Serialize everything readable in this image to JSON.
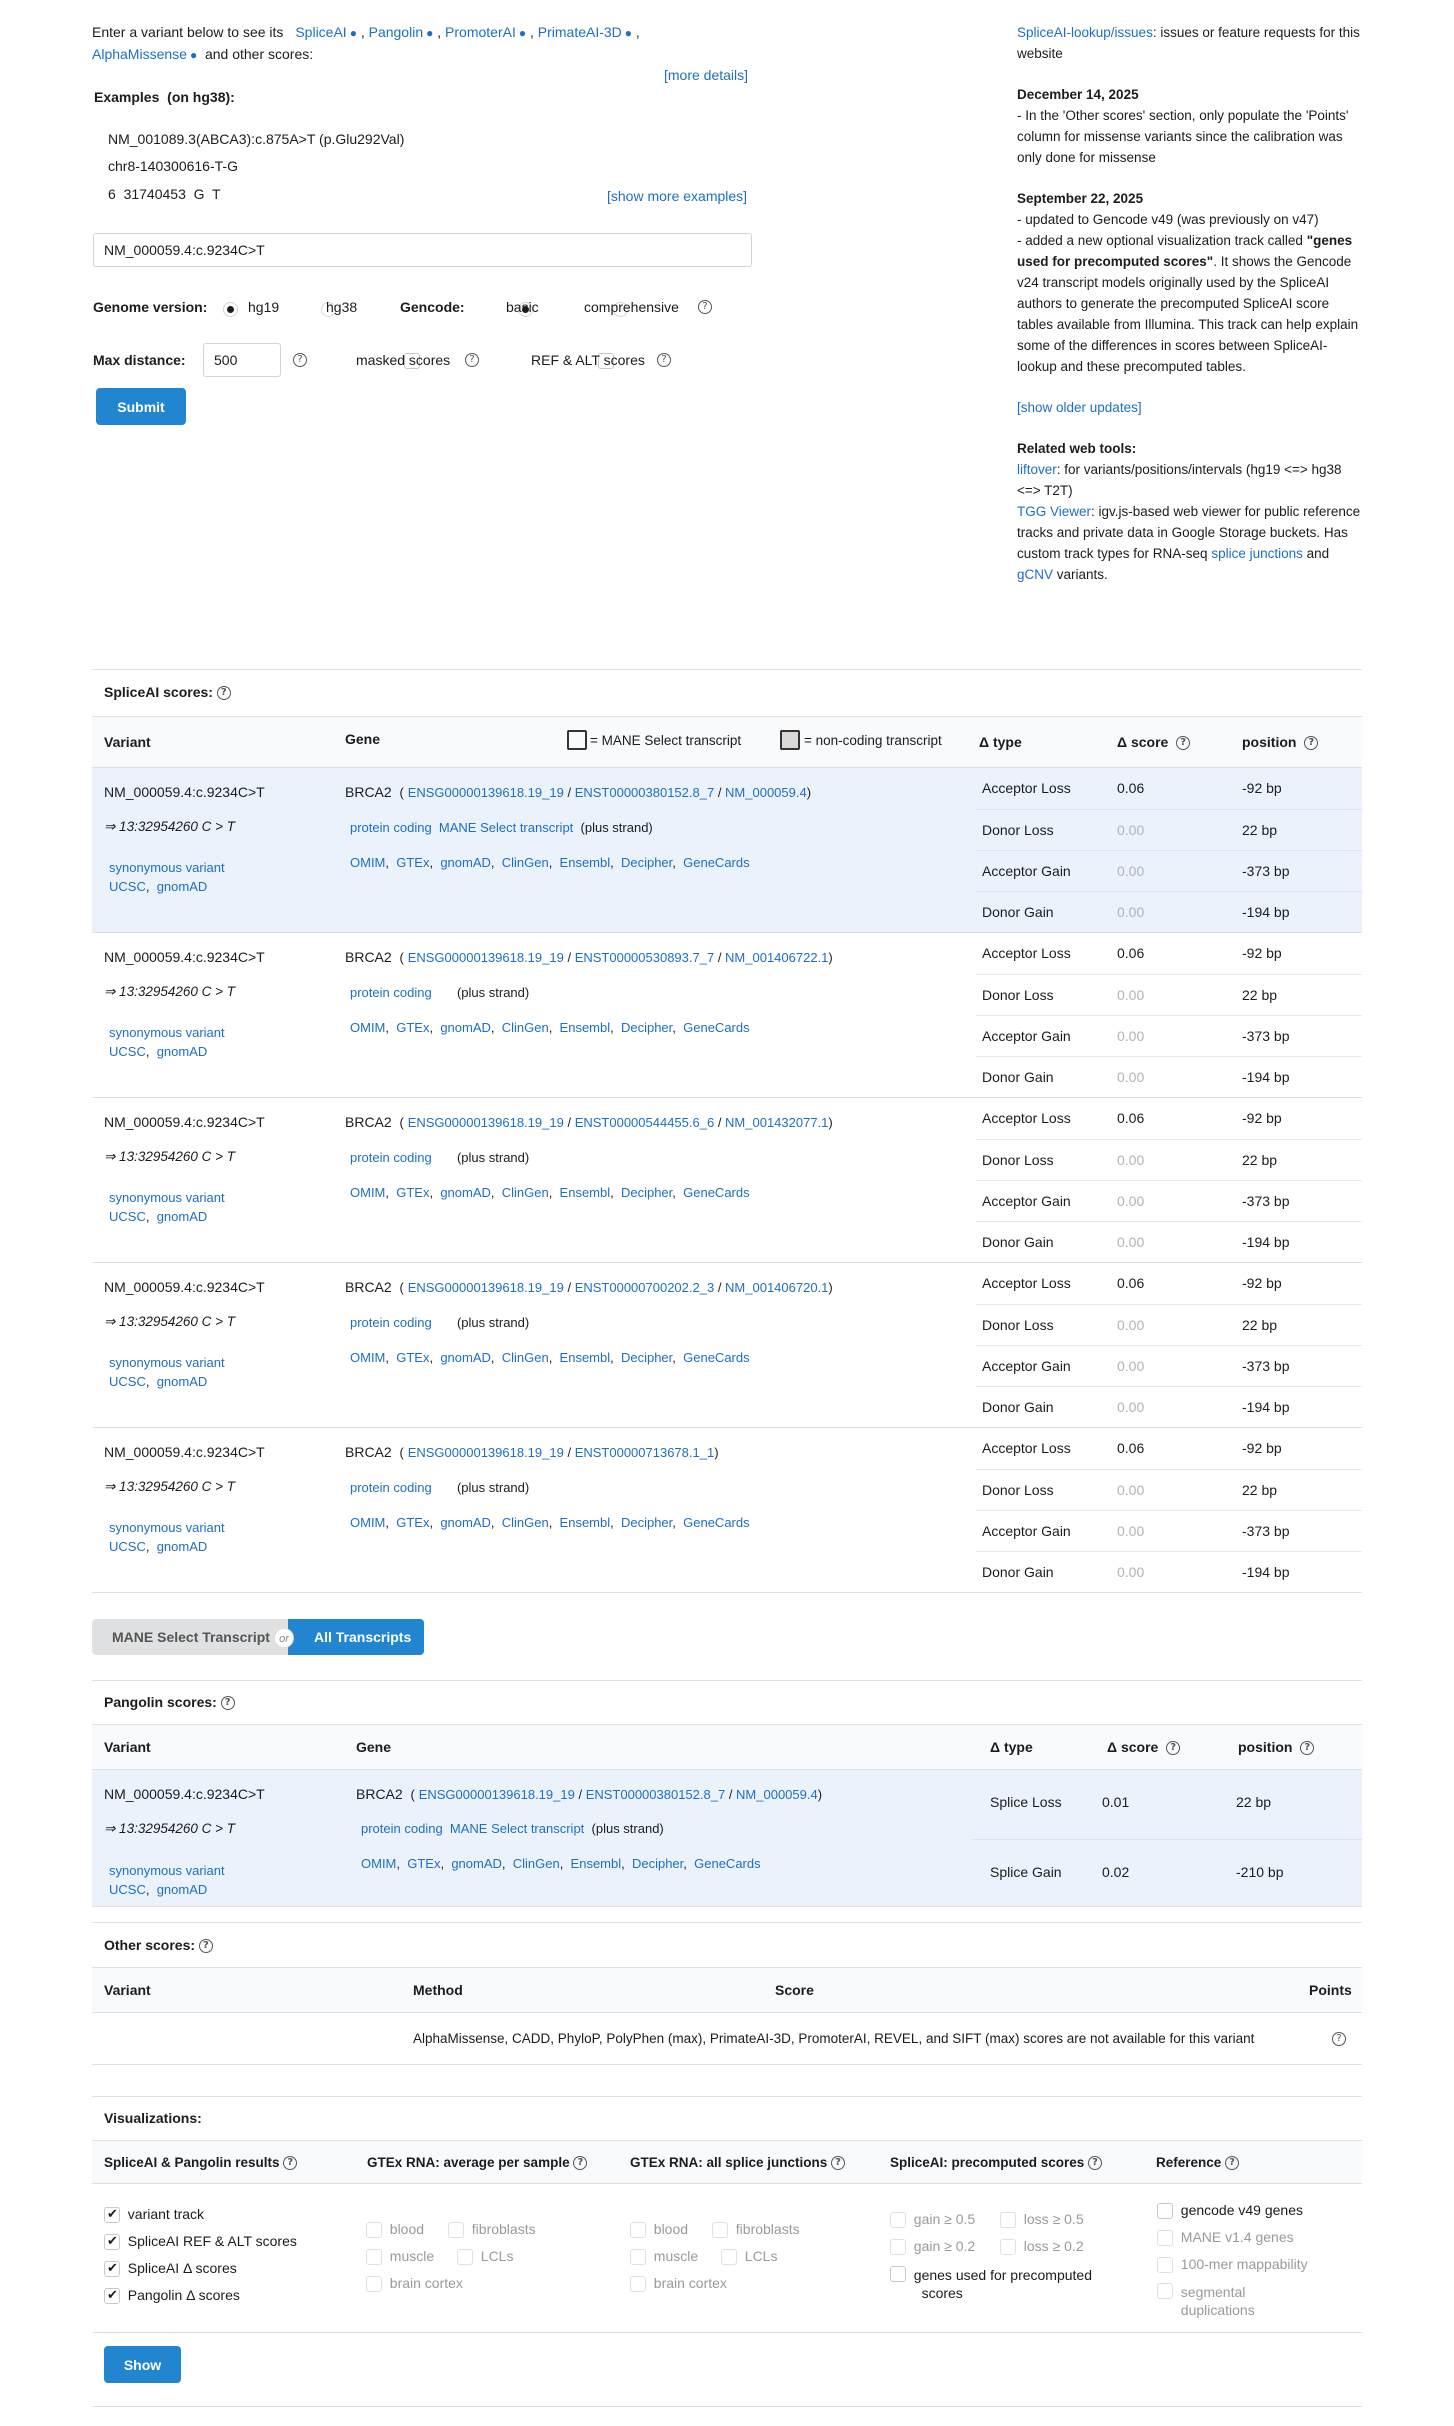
{
  "intro": {
    "text_before": "Enter a variant below to see its",
    "tools": [
      "SpliceAI",
      "Pangolin",
      "PromoterAI",
      "PrimateAI-3D",
      "AlphaMissense"
    ],
    "text_after": "and other scores:",
    "more_details": "[more details]"
  },
  "examples": {
    "label": "Examples",
    "genome_note": "(on hg38):",
    "items": [
      "NM_001089.3(ABCA3):c.875A>T (p.Glu292Val)",
      "chr8-140300616-T-G",
      "6  31740453  G  T"
    ],
    "show_more": "[show more examples]"
  },
  "form": {
    "variant_value": "NM_000059.4:c.9234C>T",
    "genome_label": "Genome version:",
    "genome_options": [
      "hg19",
      "hg38"
    ],
    "gencode_label": "Gencode:",
    "gencode_options": [
      "basic",
      "comprehensive"
    ],
    "max_distance_label": "Max distance:",
    "max_distance_value": "500",
    "masked_label": "masked scores",
    "ref_alt_label": "REF & ALT scores",
    "submit": "Submit"
  },
  "news": {
    "issues_link": "SpliceAI-lookup/issues",
    "issues_text": ": issues or feature requests for this website",
    "d1_date": "December 14, 2025",
    "d1_text": "- In the 'Other scores' section, only populate the 'Points' column for missense variants since the calibration was only done for missense",
    "d2_date": "September 22, 2025",
    "d2_line1": "- updated to Gencode v49 (was previously on v47)",
    "d2_line2a": "- added a new optional visualization track called",
    "d2_bold": "\"genes used for precomputed scores\"",
    "d2_line2b": ". It shows the Gencode v24 transcript models originally used by the SpliceAI authors to generate the precomputed SpliceAI score tables available from Illumina. This track can help explain some of the differences in scores between SpliceAI-lookup and these precomputed tables.",
    "older": "[show older updates]",
    "related_title": "Related web tools:",
    "liftover": "liftover",
    "liftover_text": ": for variants/positions/intervals (hg19 <=> hg38 <=> T2T)",
    "tgg": "TGG Viewer",
    "tgg_text": ": igv.js-based web viewer for public reference tracks and private data in Google Storage buckets. Has custom track types for RNA-seq",
    "splice_junctions": "splice junctions",
    "and_text": "and",
    "gcnv": "gCNV",
    "variants_text": "variants."
  },
  "spliceai": {
    "title": "SpliceAI scores:",
    "headers": {
      "variant": "Variant",
      "gene": "Gene",
      "mane_legend": "= MANE Select transcript",
      "noncoding_legend": "= non-coding transcript",
      "type": "Δ type",
      "score": "Δ score",
      "position": "position"
    },
    "rows": [
      {
        "variant": "NM_000059.4:c.9234C>T",
        "coords": "⇒ 13:32954260 C > T",
        "consequence": "synonymous variant",
        "gene": "BRCA2",
        "ensg": "ENSG00000139618.19_19",
        "enst": "ENST00000380152.8_7",
        "nm": "NM_000059.4",
        "biotype": "protein coding",
        "mane": "MANE Select transcript",
        "strand": "(plus strand)",
        "scores": [
          {
            "type": "Acceptor Loss",
            "score": "0.06",
            "pos": "-92 bp"
          },
          {
            "type": "Donor Loss",
            "score": "0.00",
            "pos": "22 bp"
          },
          {
            "type": "Acceptor Gain",
            "score": "0.00",
            "pos": "-373 bp"
          },
          {
            "type": "Donor Gain",
            "score": "0.00",
            "pos": "-194 bp"
          }
        ]
      },
      {
        "variant": "NM_000059.4:c.9234C>T",
        "coords": "⇒ 13:32954260 C > T",
        "consequence": "synonymous variant",
        "gene": "BRCA2",
        "ensg": "ENSG00000139618.19_19",
        "enst": "ENST00000530893.7_7",
        "nm": "NM_001406722.1",
        "biotype": "protein coding",
        "mane": "",
        "strand": "(plus strand)",
        "scores": [
          {
            "type": "Acceptor Loss",
            "score": "0.06",
            "pos": "-92 bp"
          },
          {
            "type": "Donor Loss",
            "score": "0.00",
            "pos": "22 bp"
          },
          {
            "type": "Acceptor Gain",
            "score": "0.00",
            "pos": "-373 bp"
          },
          {
            "type": "Donor Gain",
            "score": "0.00",
            "pos": "-194 bp"
          }
        ]
      },
      {
        "variant": "NM_000059.4:c.9234C>T",
        "coords": "⇒ 13:32954260 C > T",
        "consequence": "synonymous variant",
        "gene": "BRCA2",
        "ensg": "ENSG00000139618.19_19",
        "enst": "ENST00000544455.6_6",
        "nm": "NM_001432077.1",
        "biotype": "protein coding",
        "mane": "",
        "strand": "(plus strand)",
        "scores": [
          {
            "type": "Acceptor Loss",
            "score": "0.06",
            "pos": "-92 bp"
          },
          {
            "type": "Donor Loss",
            "score": "0.00",
            "pos": "22 bp"
          },
          {
            "type": "Acceptor Gain",
            "score": "0.00",
            "pos": "-373 bp"
          },
          {
            "type": "Donor Gain",
            "score": "0.00",
            "pos": "-194 bp"
          }
        ]
      },
      {
        "variant": "NM_000059.4:c.9234C>T",
        "coords": "⇒ 13:32954260 C > T",
        "consequence": "synonymous variant",
        "gene": "BRCA2",
        "ensg": "ENSG00000139618.19_19",
        "enst": "ENST00000700202.2_3",
        "nm": "NM_001406720.1",
        "biotype": "protein coding",
        "mane": "",
        "strand": "(plus strand)",
        "scores": [
          {
            "type": "Acceptor Loss",
            "score": "0.06",
            "pos": "-92 bp"
          },
          {
            "type": "Donor Loss",
            "score": "0.00",
            "pos": "22 bp"
          },
          {
            "type": "Acceptor Gain",
            "score": "0.00",
            "pos": "-373 bp"
          },
          {
            "type": "Donor Gain",
            "score": "0.00",
            "pos": "-194 bp"
          }
        ]
      },
      {
        "variant": "NM_000059.4:c.9234C>T",
        "coords": "⇒ 13:32954260 C > T",
        "consequence": "synonymous variant",
        "gene": "BRCA2",
        "ensg": "ENSG00000139618.19_19",
        "enst": "ENST00000713678.1_1",
        "nm": "",
        "biotype": "protein coding",
        "mane": "",
        "strand": "(plus strand)",
        "scores": [
          {
            "type": "Acceptor Loss",
            "score": "0.06",
            "pos": "-92 bp"
          },
          {
            "type": "Donor Loss",
            "score": "0.00",
            "pos": "22 bp"
          },
          {
            "type": "Acceptor Gain",
            "score": "0.00",
            "pos": "-373 bp"
          },
          {
            "type": "Donor Gain",
            "score": "0.00",
            "pos": "-194 bp"
          }
        ]
      }
    ],
    "ext_links": [
      "OMIM",
      "GTEx",
      "gnomAD",
      "ClinGen",
      "Ensembl",
      "Decipher",
      "GeneCards"
    ],
    "var_links": [
      "UCSC",
      "gnomAD"
    ]
  },
  "toggle": {
    "left": "MANE Select Transcript",
    "or": "or",
    "right": "All Transcripts"
  },
  "pangolin": {
    "title": "Pangolin scores:",
    "headers": {
      "variant": "Variant",
      "gene": "Gene",
      "type": "Δ type",
      "score": "Δ score",
      "position": "position"
    },
    "row": {
      "variant": "NM_000059.4:c.9234C>T",
      "coords": "⇒ 13:32954260 C > T",
      "consequence": "synonymous variant",
      "gene": "BRCA2",
      "ensg": "ENSG00000139618.19_19",
      "enst": "ENST00000380152.8_7",
      "nm": "NM_000059.4",
      "biotype": "protein coding",
      "mane": "MANE Select transcript",
      "strand": "(plus strand)"
    },
    "scores": [
      {
        "type": "Splice Loss",
        "score": "0.01",
        "pos": "22 bp"
      },
      {
        "type": "Splice Gain",
        "score": "0.02",
        "pos": "-210 bp"
      }
    ]
  },
  "other": {
    "title": "Other scores:",
    "headers": {
      "variant": "Variant",
      "method": "Method",
      "score": "Score",
      "points": "Points"
    },
    "message": "AlphaMissense, CADD, PhyloP, PolyPhen (max), PrimateAI-3D, PromoterAI, REVEL, and SIFT (max) scores are not available for this variant"
  },
  "vis": {
    "title": "Visualizations:",
    "headers": [
      "SpliceAI & Pangolin results",
      "GTEx RNA: average per sample",
      "GTEx RNA: all splice junctions",
      "SpliceAI: precomputed scores",
      "Reference"
    ],
    "results": [
      "variant track",
      "SpliceAI REF & ALT scores",
      "SpliceAI Δ scores",
      "Pangolin Δ scores"
    ],
    "gtex_avg": [
      "blood",
      "fibroblasts",
      "muscle",
      "LCLs",
      "brain cortex"
    ],
    "gtex_junc": [
      "blood",
      "fibroblasts",
      "muscle",
      "LCLs",
      "brain cortex"
    ],
    "precomp": [
      "gain ≥ 0.5",
      "loss ≥ 0.5",
      "gain ≥ 0.2",
      "loss ≥ 0.2"
    ],
    "genes_used_1": "genes used for precomputed",
    "genes_used_2": "scores",
    "reference": [
      "gencode v49 genes",
      "MANE v1.4 genes",
      "100-mer mappability",
      "segmental",
      "duplications"
    ],
    "show": "Show"
  }
}
